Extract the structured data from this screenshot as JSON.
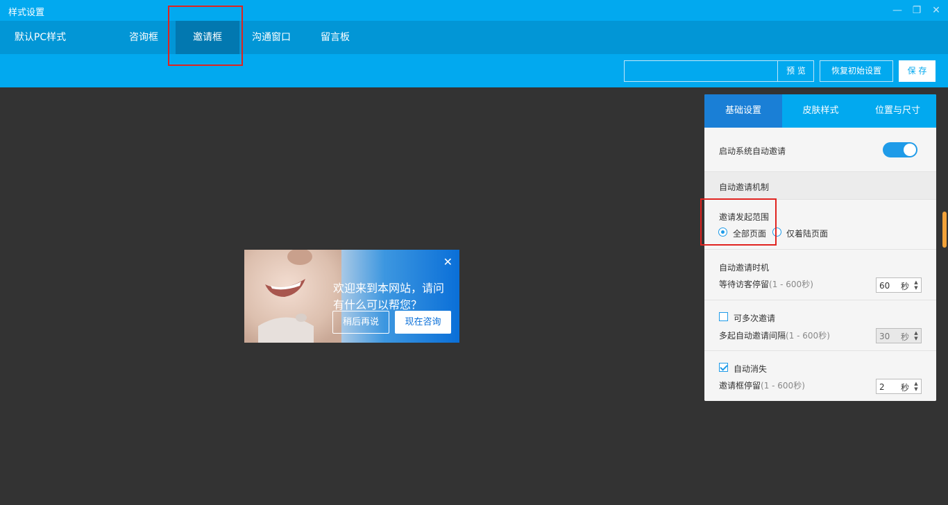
{
  "window": {
    "title": "样式设置"
  },
  "nav": {
    "items": [
      "默认PC样式",
      "咨询框",
      "邀请框",
      "沟通窗口",
      "留言板"
    ]
  },
  "toolbar": {
    "search_value": "",
    "preview_label": "预 览",
    "restore_label": "恢复初始设置",
    "save_label": "保 存"
  },
  "popup": {
    "message": "欢迎来到本网站，请问有什么可以帮您？",
    "later_label": "稍后再说",
    "consult_label": "现在咨询",
    "close_glyph": "✕"
  },
  "panel": {
    "tabs": [
      "基础设置",
      "皮肤样式",
      "位置与尺寸"
    ],
    "auto_invite_label": "启动系统自动邀请",
    "auto_invite_on": true,
    "mechanism_heading": "自动邀请机制",
    "range": {
      "label": "邀请发起范围",
      "options": [
        "全部页面",
        "仅着陆页面"
      ],
      "selected": "全部页面"
    },
    "timing": {
      "label": "自动邀请时机",
      "stay_label": "等待访客停留",
      "stay_hint": "(1 - 600秒)",
      "stay_value": "60",
      "unit": "秒"
    },
    "multi": {
      "label": "可多次邀请",
      "checked": false,
      "interval_label": "多起自动邀请间隔",
      "interval_hint": "(1 - 600秒)",
      "interval_value": "30",
      "unit": "秒"
    },
    "dismiss": {
      "label": "自动消失",
      "checked": true,
      "stay_label": "邀请框停留",
      "stay_hint": "(1 - 600秒)",
      "stay_value": "2",
      "unit": "秒"
    }
  },
  "colors": {
    "brand": "#02a9ef",
    "nav": "#0296d6",
    "nav_active": "#0278b0",
    "highlight": "#e0231f",
    "canvas": "#333333"
  }
}
